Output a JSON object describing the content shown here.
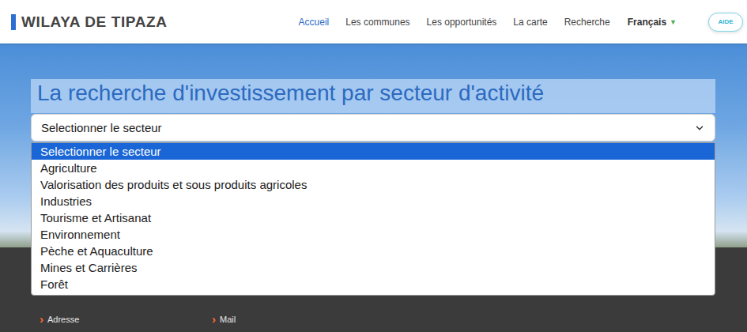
{
  "header": {
    "brand": "WILAYA DE TIPAZA",
    "nav": [
      {
        "label": "Accueil",
        "selected": true
      },
      {
        "label": "Les communes",
        "selected": false
      },
      {
        "label": "Les opportunités",
        "selected": false
      },
      {
        "label": "La carte",
        "selected": false
      },
      {
        "label": "Recherche",
        "selected": false
      }
    ],
    "language": {
      "label": "Français",
      "icon": "▼"
    },
    "help_button": "AIDE"
  },
  "search": {
    "title": "La recherche d'investissement par secteur d'activité",
    "select": {
      "value": "Selectionner le secteur",
      "expanded": true
    },
    "options": [
      {
        "label": "Selectionner le secteur",
        "selected": true
      },
      {
        "label": "Agriculture",
        "selected": false
      },
      {
        "label": "Valorisation des produits et sous produits agricoles",
        "selected": false
      },
      {
        "label": "Industries",
        "selected": false
      },
      {
        "label": "Tourisme et Artisanat",
        "selected": false
      },
      {
        "label": "Environnement",
        "selected": false
      },
      {
        "label": "Pèche et Aquaculture",
        "selected": false
      },
      {
        "label": "Mines et Carrières",
        "selected": false
      },
      {
        "label": "Forêt",
        "selected": false
      }
    ]
  },
  "footer": {
    "links": [
      {
        "icon": "›",
        "label": "Adresse"
      },
      {
        "icon": "›",
        "label": "Mail"
      }
    ]
  }
}
